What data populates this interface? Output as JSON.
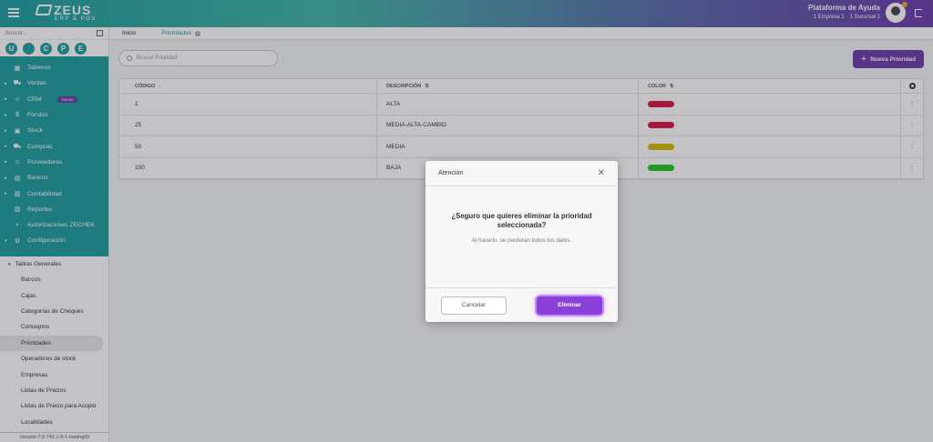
{
  "header": {
    "logo_main": "ZEUS",
    "logo_sub": "ERP & POS",
    "help_title": "Plataforma de Ayuda",
    "company": "1 Empresa 1",
    "branch": "1 Sucursal 1"
  },
  "sidebar": {
    "search_placeholder": "Buscar...",
    "quick_buttons": [
      "U",
      "",
      "C",
      "P",
      "E"
    ],
    "menu": [
      {
        "label": "Tableros",
        "icon": "dashboard-icon",
        "glyph": "▦"
      },
      {
        "label": "Ventas",
        "icon": "cart-icon",
        "glyph": "🛒"
      },
      {
        "label": "CRM",
        "icon": "people-icon",
        "glyph": "👥",
        "badge": "Nuevo"
      },
      {
        "label": "Fondos",
        "icon": "dollar-icon",
        "glyph": "$"
      },
      {
        "label": "Stock",
        "icon": "stock-icon",
        "glyph": "▣"
      },
      {
        "label": "Compras",
        "icon": "cart-icon",
        "glyph": "🛒"
      },
      {
        "label": "Proveedores",
        "icon": "people-icon",
        "glyph": "👥"
      },
      {
        "label": "Bancos",
        "icon": "bank-icon",
        "glyph": "🏛"
      },
      {
        "label": "Contabilidad",
        "icon": "book-icon",
        "glyph": "📖"
      },
      {
        "label": "Reportes",
        "icon": "report-icon",
        "glyph": "📄"
      },
      {
        "label": "Autorizaciones ZECHEK",
        "icon": "lock-icon",
        "glyph": "🔒"
      },
      {
        "label": "Configuración",
        "icon": "gear-icon",
        "glyph": "⚙"
      }
    ],
    "sub_header": "Tablas Generales",
    "sub_items": [
      "Bancos",
      "Cajas",
      "Categorías de Cheques",
      "Conceptos",
      "Prioridades",
      "Operadores de stock",
      "Empresas",
      "Listas de Precios",
      "Listas de Precio para Acopio",
      "Localidades"
    ],
    "active_sub": "Prioridades",
    "version": "Versión 7.6.742.1-8-1-testing09"
  },
  "tabs": [
    {
      "label": "Inicio",
      "active": false
    },
    {
      "label": "Prioridades",
      "active": true
    }
  ],
  "main": {
    "search_placeholder": "Buscar Prioridad",
    "new_button": "Nueva Prioridad",
    "columns": [
      "CÓDIGO",
      "DESCRIPCIÓN",
      "COLOR"
    ],
    "rows": [
      {
        "code": "1",
        "description": "ALTA",
        "color": "#d6143c"
      },
      {
        "code": "25",
        "description": "MEDIA-ALTA-CAMBIO",
        "color": "#d6143c"
      },
      {
        "code": "50",
        "description": "MEDIA",
        "color": "#d4b800"
      },
      {
        "code": "100",
        "description": "BAJA",
        "color": "#1ec41e"
      }
    ]
  },
  "modal": {
    "title": "Atención",
    "question": "¿Seguro que quieres eliminar la prioridad seleccionada?",
    "subtitle": "Al hacerlo, se perderán todos tus datos.",
    "cancel": "Cancelar",
    "confirm": "Eliminar"
  },
  "colors": {
    "accent": "#1b9c9c",
    "brand_purple": "#6a3aa8",
    "delete_button": "#8a3fd6"
  }
}
